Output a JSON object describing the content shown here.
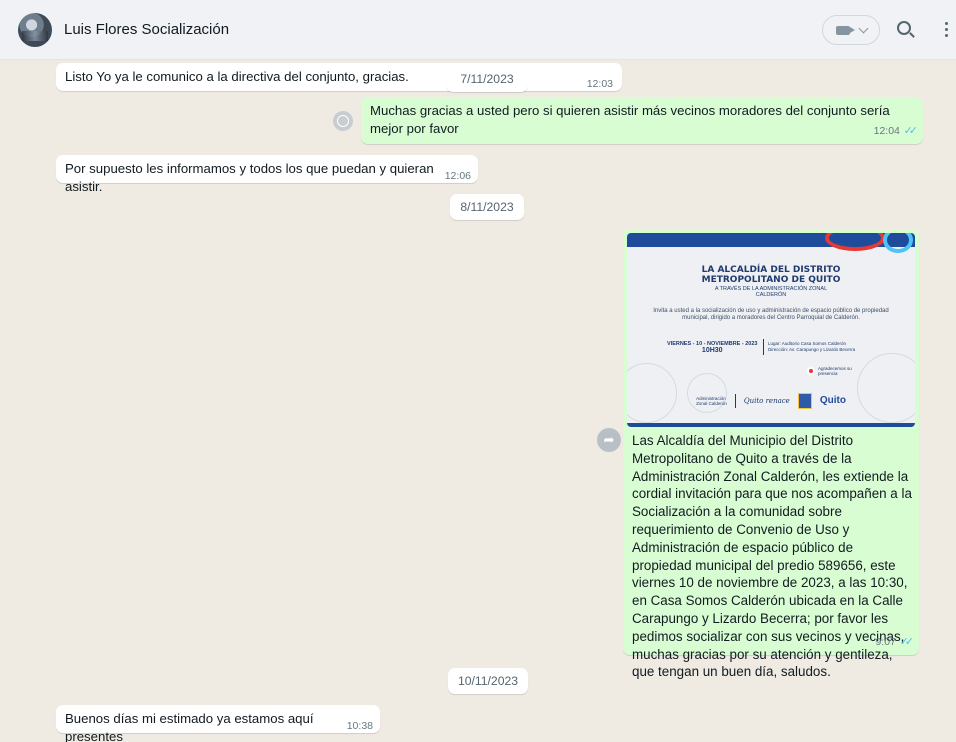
{
  "header": {
    "contact_name": "Luis Flores Socialización"
  },
  "messages": [
    {
      "type": "in",
      "text": "Listo Yo ya le comunico a la directiva del conjunto, gracias.",
      "time": "12:03"
    },
    {
      "type": "out",
      "text": "Muchas gracias a usted pero si quieren asistir más vecinos moradores del conjunto sería mejor por favor",
      "time": "12:04",
      "ticks": "✓✓"
    },
    {
      "type": "in",
      "text": "Por supuesto les informamos y todos los que puedan y quieran asistir.",
      "time": "12:06"
    },
    {
      "type": "out",
      "text": "Las Alcaldía del  Municipio del Distrito Metropolitano de Quito a través de la Administración Zonal Calderón, les extiende la cordial invitación para que nos acompañen a la Socialización a la comunidad sobre requerimiento de Convenio de Uso y Administración de espacio público de propiedad municipal del predio 589656, este viernes 10 de noviembre de 2023, a las 10:30, en Casa Somos Calderón ubicada en la Calle Carapungo y Lizardo Becerra; por favor les pedimos socializar con sus vecinos y vecinas, muchas gracias por su atención y gentileza, que tengan un buen día, saludos.",
      "time": "9:07",
      "ticks": "✓✓"
    },
    {
      "type": "in",
      "text": "Buenos días mi estimado ya estamos aquí presentes",
      "time": "10:38"
    }
  ],
  "dates": [
    "7/11/2023",
    "8/11/2023",
    "10/11/2023"
  ],
  "poster": {
    "title_line1": "LA ALCALDÍA DEL DISTRITO",
    "title_line2": "METROPOLITANO DE QUITO",
    "subtitle_line1": "A TRAVÉS DE LA ADMINISTRACIÓN ZONAL",
    "subtitle_line2": "CALDERÓN",
    "body": "Invita a usted a la socialización de uso y administración de espacio público de propiedad municipal, dirigido a moradores del Centro Parroquial de Calderón.",
    "when_line1": "VIERNES - 10 - NOVIEMBRE - 2023",
    "when_line2": "10H30",
    "where_line1": "Lugar: Auditorio Casa Somos Calderón",
    "where_line2": "Dirección: Av. Carapungo y Lizardo Becerra",
    "thanks_line1": "Agradecemos su",
    "thanks_line2": "presencia",
    "admin_line1": "Administración",
    "admin_line2": "Zonal Calderón",
    "renace": "Quito renace",
    "quito": "Quito"
  },
  "colors": {
    "incoming_bubble": "#ffffff",
    "outgoing_bubble": "#d9fdd3",
    "chat_background": "#efeae2",
    "read_ticks": "#53bdeb"
  }
}
